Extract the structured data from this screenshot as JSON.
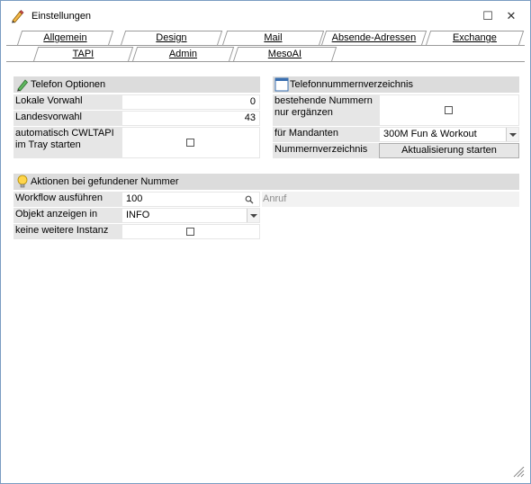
{
  "window": {
    "title": "Einstellungen",
    "maximize_glyph": "☐",
    "close_glyph": "✕",
    "icon": "pencil-icon"
  },
  "tabs_row1": [
    {
      "label": "Allgemein"
    },
    {
      "label": "Design"
    },
    {
      "label": "Mail"
    },
    {
      "label": "Absende-Adressen"
    },
    {
      "label": "Exchange"
    }
  ],
  "tabs_row2": [
    {
      "label": "TAPI",
      "active": true
    },
    {
      "label": "Admin"
    },
    {
      "label": "MesoAI"
    }
  ],
  "telefon_optionen": {
    "header": "Telefon Optionen",
    "icon": "pencil-icon",
    "rows": [
      {
        "label": "Lokale Vorwahl",
        "value": "0"
      },
      {
        "label": "Landesvorwahl",
        "value": "43"
      },
      {
        "label": "automatisch CWLTAPI im Tray starten",
        "checked": false
      }
    ]
  },
  "telefonnummernverzeichnis": {
    "header": "Telefonnummernverzeichnis",
    "icon": "window-icon",
    "rows": [
      {
        "label": "bestehende Nummern nur ergänzen",
        "checked": false
      },
      {
        "label": "für Mandanten",
        "value": "300M Fun & Workout"
      },
      {
        "label": "Nummernverzeichnis",
        "button": "Aktualisierung starten"
      }
    ]
  },
  "aktionen": {
    "header": "Aktionen bei gefundener Nummer",
    "icon": "lightbulb-icon",
    "rows": [
      {
        "label": "Workflow ausführen",
        "value": "100",
        "extra": "Anruf"
      },
      {
        "label": "Objekt anzeigen in",
        "value": "INFO"
      },
      {
        "label": "keine weitere Instanz",
        "checked": false
      }
    ]
  },
  "colors": {
    "header_bg": "#dcdcdc",
    "label_bg": "#e6e6e6",
    "border": "#7a9cc2"
  }
}
